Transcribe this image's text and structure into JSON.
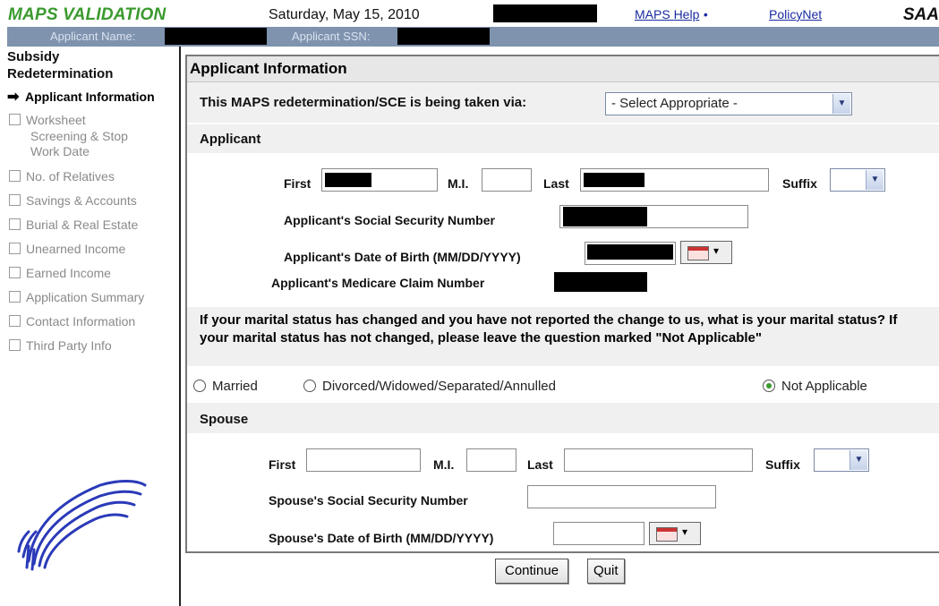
{
  "header": {
    "app_title": "MAPS VALIDATION",
    "date": "Saturday, May 15, 2010",
    "help_link": "MAPS Help",
    "help_bullet": "•",
    "policynet_link": "PolicyNet",
    "saa_text": "SAA"
  },
  "strip": {
    "applicant_name_label": "Applicant Name:",
    "applicant_ssn_label": "Applicant SSN:"
  },
  "sidebar": {
    "heading_line1": "Subsidy",
    "heading_line2": "Redetermination",
    "current": "Applicant Information",
    "items": [
      {
        "label": "Worksheet"
      },
      {
        "label": "Screening & Stop Work Date",
        "line1": "Screening & Stop",
        "line2": "Work Date"
      },
      {
        "label": "No. of Relatives"
      },
      {
        "label": "Savings & Accounts"
      },
      {
        "label": "Burial & Real Estate"
      },
      {
        "label": "Unearned Income"
      },
      {
        "label": "Earned Income"
      },
      {
        "label": "Application Summary"
      },
      {
        "label": "Contact Information"
      },
      {
        "label": "Third Party Info"
      }
    ]
  },
  "main": {
    "title": "Applicant Information",
    "via_label": "This MAPS redetermination/SCE is being taken via:",
    "via_select": "- Select Appropriate -",
    "applicant_section": "Applicant",
    "first_label": "First",
    "mi_label": "M.I.",
    "last_label": "Last",
    "suffix_label": "Suffix",
    "ssn_label": "Applicant's Social Security Number",
    "dob_label": "Applicant's Date of Birth (MM/DD/YYYY)",
    "medicare_label": "Applicant's Medicare Claim Number",
    "marital_question": "If your marital status has changed and you have not reported the change to us, what is your marital status? If your marital status has not changed, please leave the question marked \"Not Applicable\"",
    "marital_options": [
      "Married",
      "Divorced/Widowed/Separated/Annulled",
      "Not Applicable"
    ],
    "marital_selected": "Not Applicable",
    "spouse_section": "Spouse",
    "spouse_first_label": "First",
    "spouse_mi_label": "M.I.",
    "spouse_last_label": "Last",
    "spouse_suffix_label": "Suffix",
    "spouse_ssn_label": "Spouse's Social Security Number",
    "spouse_dob_label": "Spouse's Date of Birth (MM/DD/YYYY)"
  },
  "buttons": {
    "continue": "Continue",
    "quit": "Quit"
  },
  "colors": {
    "title_green": "#3a9a2e",
    "strip_blue": "#7f93ae",
    "link_blue": "#1a2aa0",
    "logo_blue": "#2a3ab8"
  }
}
